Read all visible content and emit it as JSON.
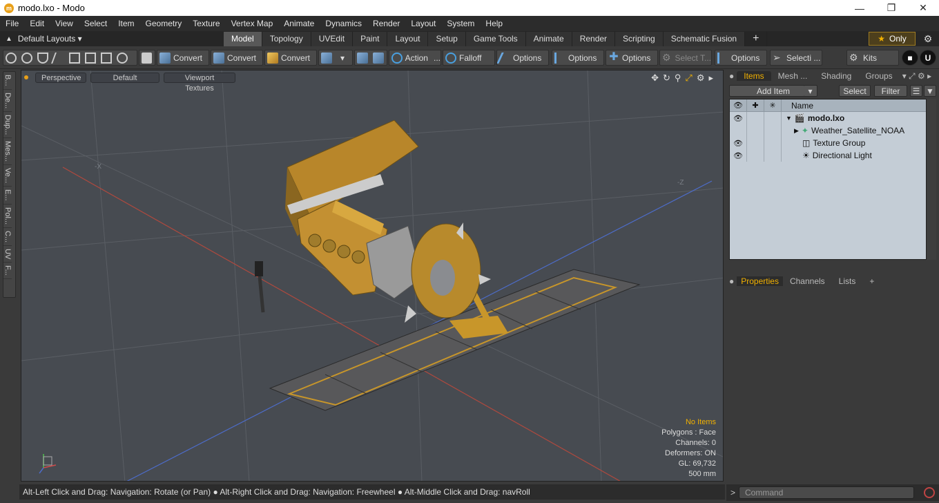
{
  "window": {
    "title": "modo.lxo - Modo",
    "icon": "modo-logo-icon"
  },
  "menu": [
    "File",
    "Edit",
    "View",
    "Select",
    "Item",
    "Geometry",
    "Texture",
    "Vertex Map",
    "Animate",
    "Dynamics",
    "Render",
    "Layout",
    "System",
    "Help"
  ],
  "layout": {
    "label": "Default Layouts",
    "tabs": [
      "Model",
      "Topology",
      "UVEdit",
      "Paint",
      "Layout",
      "Setup",
      "Game Tools",
      "Animate",
      "Render",
      "Scripting",
      "Schematic Fusion"
    ],
    "active": "Model",
    "only": "Only"
  },
  "toolbar": {
    "convert1": "Convert",
    "convert2": "Convert",
    "convert3": "Convert",
    "action": "Action",
    "falloff": "Falloff",
    "options1": "Options",
    "options2": "Options",
    "options3": "Options",
    "select_t": "Select T...",
    "options4": "Options",
    "selecti": "Selecti ...",
    "kits": "Kits"
  },
  "lefttabs": [
    "B...",
    "De...",
    "Dup...",
    "Mes...",
    "Ve...",
    "E...",
    "Pol...",
    "C...",
    "UV",
    "F..."
  ],
  "viewport": {
    "perspective": "Perspective",
    "default": "Default",
    "textures": "Viewport Textures",
    "stats": {
      "items": "No Items",
      "polygons": "Polygons : Face",
      "channels": "Channels: 0",
      "deformers": "Deformers: ON",
      "gl": "GL: 69,732",
      "scale": "500 mm"
    },
    "axes": {
      "nx": "-X",
      "nz": "-Z"
    }
  },
  "status": "Alt-Left Click and Drag: Navigation: Rotate (or Pan) ● Alt-Right Click and Drag: Navigation: Freewheel ● Alt-Middle Click and Drag: navRoll",
  "items_panel": {
    "tabs": [
      "Items",
      "Mesh ...",
      "Shading",
      "Groups"
    ],
    "add_item": "Add Item",
    "select": "Select",
    "filter": "Filter",
    "col_name": "Name",
    "rows": [
      {
        "name": "modo.lxo",
        "bold": true
      },
      {
        "name": "Weather_Satellite_NOAA"
      },
      {
        "name": "Texture Group"
      },
      {
        "name": "Directional Light"
      }
    ]
  },
  "props_panel": {
    "tabs": [
      "Properties",
      "Channels",
      "Lists"
    ]
  },
  "command": {
    "placeholder": "Command"
  },
  "colors": {
    "accent": "#f2b100",
    "gold": "#c8962a",
    "grid": "#5a5e64"
  }
}
